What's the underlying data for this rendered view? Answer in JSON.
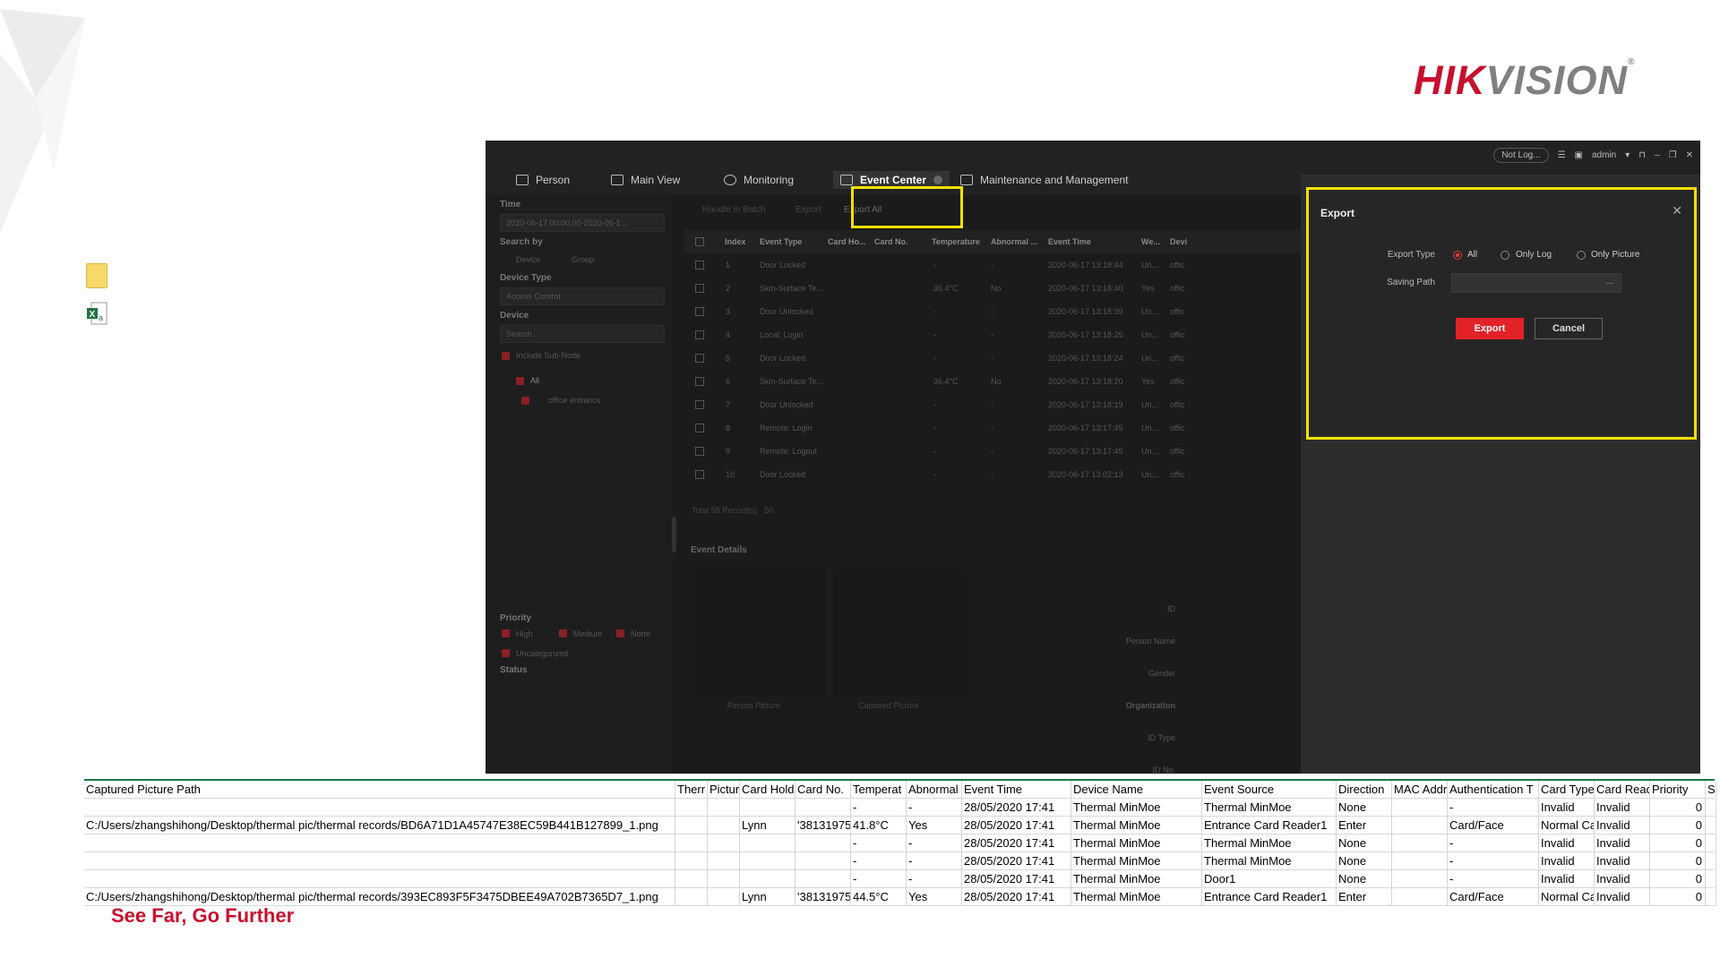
{
  "branding": {
    "logo_red": "HIK",
    "logo_gray": "VISION",
    "logo_mark": "®",
    "tagline": "See Far, Go Further",
    "brand_red": "#c8102e"
  },
  "desktop_icons": [
    {
      "name": "folder-icon"
    },
    {
      "name": "excel-icon",
      "glyph": "X"
    }
  ],
  "app": {
    "nav": [
      {
        "label": "Person",
        "icon": "person-icon"
      },
      {
        "label": "Main View",
        "icon": "main-view-icon"
      },
      {
        "label": "Monitoring",
        "icon": "monitoring-icon"
      },
      {
        "label": "Event Center",
        "icon": "event-center-icon",
        "active": true
      },
      {
        "label": "Maintenance and Management",
        "icon": "maintenance-icon"
      }
    ],
    "sysbar": {
      "status": "Not Log...",
      "user": "admin"
    },
    "left": {
      "time_label": "Time",
      "time_value": "2020-06-17 00:00:00-2020-06-1...",
      "search_by_label": "Search by",
      "search_device": "Device",
      "search_group": "Group",
      "device_type_label": "Device Type",
      "device_type_value": "Access Control",
      "device_label": "Device",
      "search_placeholder": "Search",
      "include_sub_node": "Include Sub-Node",
      "tree_all": "All",
      "tree_node": "office entrance",
      "priority_label": "Priority",
      "priority_high": "High",
      "priority_medium": "Medium",
      "priority_normal": "Norm",
      "uncategorized": "Uncategorized",
      "status_label": "Status"
    },
    "toolbar": {
      "handle": "Handle in Batch",
      "export": "Export",
      "export_all": "Export All"
    },
    "table_headers": [
      "Index",
      "Event Type",
      "Card Ho...",
      "Card No.",
      "Temperature",
      "Abnormal ...",
      "Event Time",
      "We...",
      "Devi"
    ],
    "rows": [
      {
        "index": "1",
        "type": "Door Locked",
        "temp": "-",
        "abn": "-",
        "time": "2020-06-17 13:18:44",
        "we": "Un...",
        "dev": "offic"
      },
      {
        "index": "2",
        "type": "Skin-Surface Te...",
        "temp": "36.4°C",
        "abn": "No",
        "time": "2020-06-17 13:18:40",
        "we": "Yes",
        "dev": "offic"
      },
      {
        "index": "3",
        "type": "Door Unlocked",
        "temp": "-",
        "abn": "-",
        "time": "2020-06-17 13:18:39",
        "we": "Un...",
        "dev": "offic"
      },
      {
        "index": "4",
        "type": "Local: Login",
        "temp": "-",
        "abn": "-",
        "time": "2020-06-17 13:18:25",
        "we": "Un...",
        "dev": "offic"
      },
      {
        "index": "5",
        "type": "Door Locked",
        "temp": "-",
        "abn": "-",
        "time": "2020-06-17 13:18:24",
        "we": "Un...",
        "dev": "offic"
      },
      {
        "index": "6",
        "type": "Skin-Surface Te...",
        "temp": "36.4°C",
        "abn": "No",
        "time": "2020-06-17 13:18:20",
        "we": "Yes",
        "dev": "offic"
      },
      {
        "index": "7",
        "type": "Door Unlocked",
        "temp": "-",
        "abn": "-",
        "time": "2020-06-17 13:18:19",
        "we": "Un...",
        "dev": "offic"
      },
      {
        "index": "8",
        "type": "Remote: Login",
        "temp": "-",
        "abn": "-",
        "time": "2020-06-17 13:17:45",
        "we": "Un...",
        "dev": "offic"
      },
      {
        "index": "9",
        "type": "Remote: Logout",
        "temp": "-",
        "abn": "-",
        "time": "2020-06-17 13:17:45",
        "we": "Un...",
        "dev": "offic"
      },
      {
        "index": "10",
        "type": "Door Locked",
        "temp": "-",
        "abn": "-",
        "time": "2020-06-17 13:02:13",
        "we": "Un...",
        "dev": "offic"
      }
    ],
    "footer": {
      "total": "Total 58 Record(s)",
      "page_size": "50"
    },
    "details": {
      "title": "Event Details",
      "person_picture": "Person Picture",
      "captured_picture": "Captured Picture",
      "fields": [
        "ID",
        "Person Name",
        "Gender",
        "Organization",
        "ID Type",
        "ID No."
      ]
    },
    "export_dialog": {
      "title": "Export",
      "export_type_label": "Export Type",
      "opt_all": "All",
      "opt_log": "Only Log",
      "opt_picture": "Only Picture",
      "saving_path_label": "Saving Path",
      "path_value": "...",
      "export_btn": "Export",
      "cancel_btn": "Cancel"
    }
  },
  "sheet": {
    "headers": [
      "Captured Picture Path",
      "Therr",
      "Pictur",
      "Card Hold",
      "Card No.",
      "Temperat",
      "Abnormal",
      "Event Time",
      "Device Name",
      "Event Source",
      "Direction",
      "MAC Addr",
      "Authentication T",
      "Card Type",
      "Card Read",
      "Priority",
      "S"
    ],
    "rows": [
      [
        "",
        "",
        "",
        "",
        "",
        "-",
        "-",
        "28/05/2020 17:41",
        "Thermal MinMoe",
        "Thermal MinMoe",
        "None",
        "",
        "-",
        "Invalid",
        "Invalid",
        "0",
        ""
      ],
      [
        "C:/Users/zhangshihong/Desktop/thermal pic/thermal records/BD6A71D1A45747E38EC59B441B127899_1.png",
        "",
        "",
        "Lynn",
        "'38131975",
        "41.8°C",
        "Yes",
        "28/05/2020 17:41",
        "Thermal MinMoe",
        "Entrance Card Reader1",
        "Enter",
        "",
        "Card/Face",
        "Normal Ca",
        "Invalid",
        "0",
        ""
      ],
      [
        "",
        "",
        "",
        "",
        "",
        "-",
        "-",
        "28/05/2020 17:41",
        "Thermal MinMoe",
        "Thermal MinMoe",
        "None",
        "",
        "-",
        "Invalid",
        "Invalid",
        "0",
        ""
      ],
      [
        "",
        "",
        "",
        "",
        "",
        "-",
        "-",
        "28/05/2020 17:41",
        "Thermal MinMoe",
        "Thermal MinMoe",
        "None",
        "",
        "-",
        "Invalid",
        "Invalid",
        "0",
        ""
      ],
      [
        "",
        "",
        "",
        "",
        "",
        "-",
        "-",
        "28/05/2020 17:41",
        "Thermal MinMoe",
        "Door1",
        "None",
        "",
        "-",
        "Invalid",
        "Invalid",
        "0",
        ""
      ],
      [
        "C:/Users/zhangshihong/Desktop/thermal pic/thermal records/393EC893F5F3475DBEE49A702B7365D7_1.png",
        "",
        "",
        "Lynn",
        "'38131975",
        "44.5°C",
        "Yes",
        "28/05/2020 17:41",
        "Thermal MinMoe",
        "Entrance Card Reader1",
        "Enter",
        "",
        "Card/Face",
        "Normal Ca",
        "Invalid",
        "0",
        ""
      ]
    ]
  }
}
